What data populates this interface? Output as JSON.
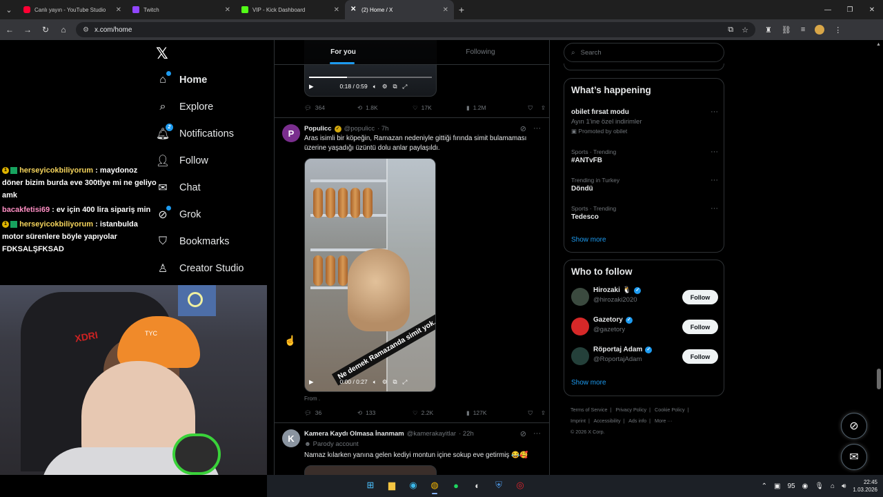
{
  "browser": {
    "tabs": [
      {
        "title": "Canlı yayın - YouTube Studio",
        "color": "#ff0033",
        "active": false
      },
      {
        "title": "Twitch",
        "color": "#9146ff",
        "active": false
      },
      {
        "title": "VIP - Kick Dashboard",
        "color": "#53fc18",
        "active": false
      },
      {
        "title": "(2) Home / X",
        "color": "#ffffff",
        "active": true
      }
    ],
    "url": "x.com/home"
  },
  "stream_chat": [
    {
      "user": "herseyicokbiliyorum",
      "text": ": maydonoz döner bizim burda eve 300tlye mi ne geliyo amk"
    },
    {
      "user": "bacakfetisi69",
      "text": ": ev için 400 lira sipariş min"
    },
    {
      "user": "herseyicokbiliyorum",
      "text": ": istanbulda motor sürenlere böyle yapıyolar FDKSALŞFKSAD"
    }
  ],
  "webcam": {
    "chair_text": "XDRI",
    "cap_text": "TYC"
  },
  "sidebar": {
    "logo": "𝕏",
    "items": [
      {
        "label": "Home",
        "icon": "home-icon"
      },
      {
        "label": "Explore",
        "icon": "search-icon"
      },
      {
        "label": "Notifications",
        "icon": "bell-icon",
        "count": "2"
      },
      {
        "label": "Follow",
        "icon": "person-add-icon"
      },
      {
        "label": "Chat",
        "icon": "mail-icon"
      },
      {
        "label": "Grok",
        "icon": "grok-icon"
      },
      {
        "label": "Bookmarks",
        "icon": "bookmark-icon"
      },
      {
        "label": "Creator Studio",
        "icon": "creator-studio-icon"
      }
    ]
  },
  "timeline": {
    "tabs": [
      "For you",
      "Following"
    ],
    "prev_video": {
      "time": "0:18 / 0:59",
      "progress": 0.31
    },
    "prev_actions": {
      "replies": "364",
      "reposts": "1.8K",
      "likes": "17K",
      "views": "1.2M"
    },
    "tweets": [
      {
        "name": "Populicc",
        "handle": "@populicc",
        "time": "· 7h",
        "text": "Aras isimli bir köpeğin, Ramazan nedeniyle gittiği fırında simit bulamaması üzerine yaşadığı üzüntü dolu anlar paylaşıldı.",
        "video_caption": "Ne demek Ramazanda simit yok. 🐶🐶",
        "video_time": "0:00 / 0:27",
        "from": "From .",
        "actions": {
          "replies": "36",
          "reposts": "133",
          "likes": "2.2K",
          "views": "127K"
        }
      },
      {
        "name": "Kamera Kaydı Olmasa İnanmam",
        "handle": "@kamerakayitlar",
        "time": "· 22h",
        "parody": "Parody account",
        "text": "Namaz kılarken yanına gelen kediyi montun içine sokup eve getirmiş 😂🥰"
      }
    ]
  },
  "right": {
    "search_placeholder": "Search",
    "happening_title": "What’s happening",
    "trends": [
      {
        "meta": "",
        "name": "obilet fırsat modu",
        "sub": "Ayın 1'ine özel indirimler",
        "promo": "Promoted by obilet"
      },
      {
        "meta": "Sports · Trending",
        "name": "#ANTvFB",
        "sub": "",
        "promo": ""
      },
      {
        "meta": "Trending in Turkey",
        "name": "Döndü",
        "sub": "",
        "promo": ""
      },
      {
        "meta": "Sports · Trending",
        "name": "Tedesco",
        "sub": "",
        "promo": ""
      }
    ],
    "show_more": "Show more",
    "who_title": "Who to follow",
    "who": [
      {
        "name": "Hirozaki",
        "emoji": "🐧",
        "handle": "@hirozaki2020",
        "button": "Follow",
        "color": "#3b4a3f"
      },
      {
        "name": "Gazetory",
        "emoji": "",
        "handle": "@gazetory",
        "button": "Follow",
        "color": "#d62828"
      },
      {
        "name": "Röportaj Adam",
        "emoji": "",
        "handle": "@RoportajAdam",
        "button": "Follow",
        "color": "#24403a"
      }
    ],
    "footer": [
      "Terms of Service",
      "|",
      "Privacy Policy",
      "|",
      "Cookie Policy",
      "|",
      "Imprint",
      "|",
      "Accessibility",
      "|",
      "Ads info",
      "|",
      "More ···",
      "© 2026 X Corp."
    ]
  },
  "taskbar": {
    "temp": "95",
    "time": "22:45",
    "date": "1.03.2026"
  }
}
